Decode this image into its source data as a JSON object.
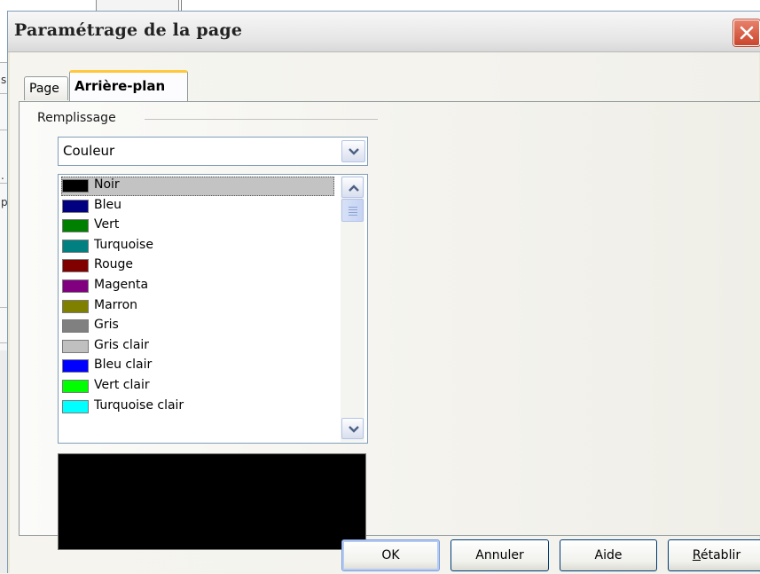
{
  "background_app": {
    "strip_chars": [
      "s",
      ".",
      "p"
    ]
  },
  "dialog": {
    "title": "Paramétrage de la page",
    "close_icon": "close-icon"
  },
  "tabs": [
    {
      "label": "Page",
      "active": false
    },
    {
      "label": "Arrière-plan",
      "active": true
    }
  ],
  "fill": {
    "group_label": "Remplissage",
    "type_selected": "Couleur",
    "colors": [
      {
        "name": "Noir",
        "color": "#000000",
        "selected": true
      },
      {
        "name": "Bleu",
        "color": "#000080"
      },
      {
        "name": "Vert",
        "color": "#008000"
      },
      {
        "name": "Turquoise",
        "color": "#008080"
      },
      {
        "name": "Rouge",
        "color": "#800000"
      },
      {
        "name": "Magenta",
        "color": "#800080"
      },
      {
        "name": "Marron",
        "color": "#808000"
      },
      {
        "name": "Gris",
        "color": "#808080"
      },
      {
        "name": "Gris clair",
        "color": "#c0c0c0"
      },
      {
        "name": "Bleu clair",
        "color": "#0000ff"
      },
      {
        "name": "Vert clair",
        "color": "#00ff00"
      },
      {
        "name": "Turquoise clair",
        "color": "#00ffff"
      }
    ],
    "preview_color": "#000000"
  },
  "buttons": {
    "ok": "OK",
    "cancel": "Annuler",
    "help": "Aide",
    "reset_first": "R",
    "reset_rest": "établir"
  }
}
